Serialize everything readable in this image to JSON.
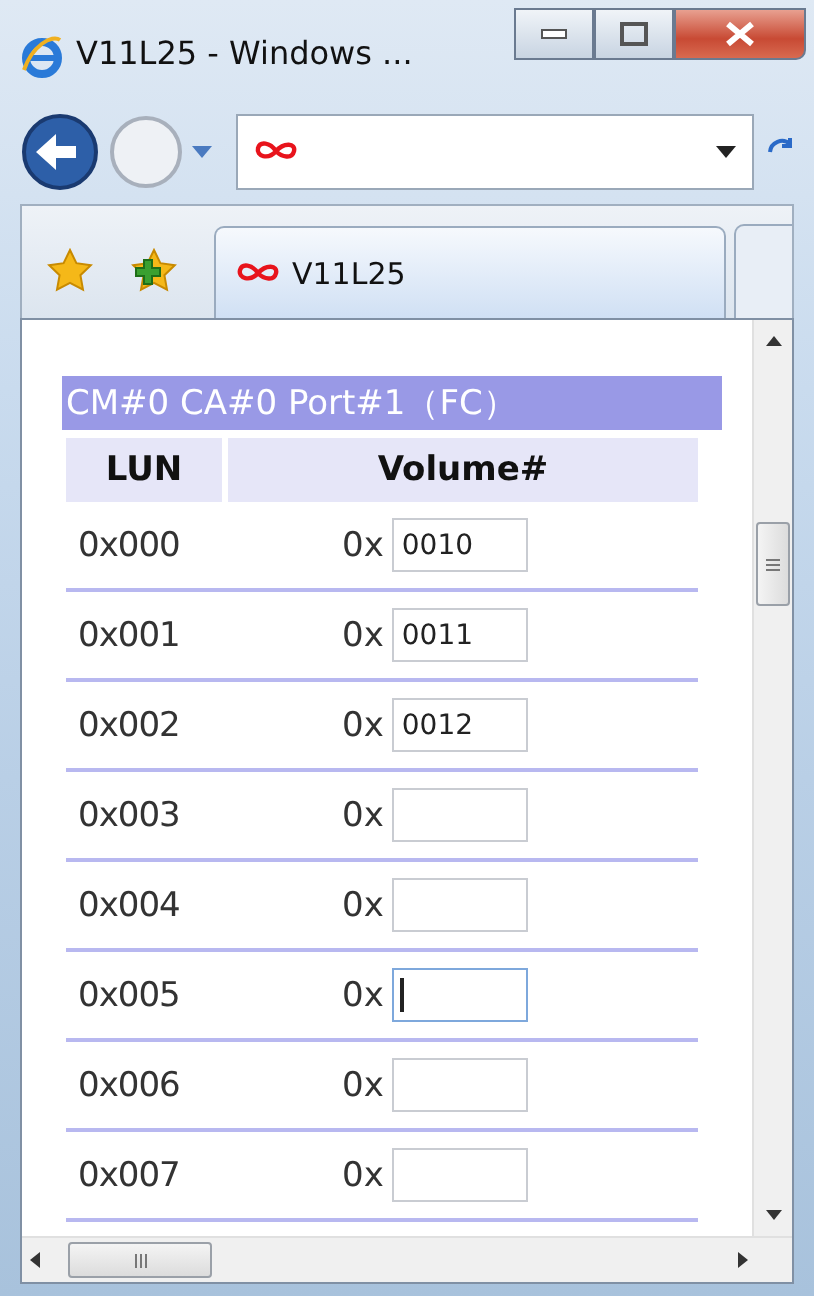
{
  "window": {
    "title": "V11L25 - Windows ..."
  },
  "tab": {
    "label": "V11L25"
  },
  "section_title": "CM#0 CA#0 Port#1（FC）",
  "columns": [
    "LUN",
    "Volume#"
  ],
  "rows": [
    {
      "lun": "0x000",
      "prefix": "0x",
      "value": "0010",
      "focused": false
    },
    {
      "lun": "0x001",
      "prefix": "0x",
      "value": "0011",
      "focused": false
    },
    {
      "lun": "0x002",
      "prefix": "0x",
      "value": "0012",
      "focused": false
    },
    {
      "lun": "0x003",
      "prefix": "0x",
      "focused": false
    },
    {
      "lun": "0x004",
      "prefix": "0x",
      "focused": false
    },
    {
      "lun": "0x005",
      "prefix": "0x",
      "focused": true
    },
    {
      "lun": "0x006",
      "prefix": "0x",
      "focused": false
    },
    {
      "lun": "0x007",
      "prefix": "0x",
      "focused": false
    }
  ]
}
